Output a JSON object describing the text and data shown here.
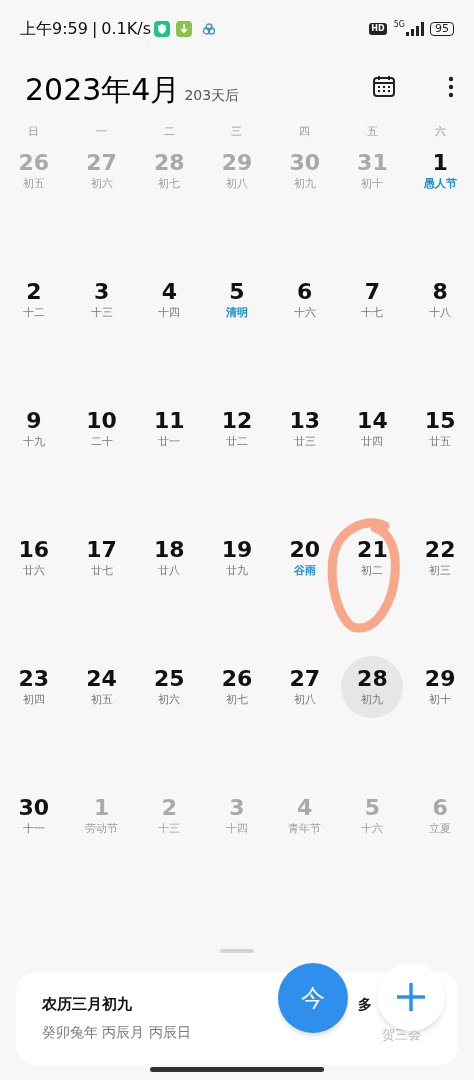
{
  "status_bar": {
    "time": "上午9:59",
    "separator": "|",
    "speed": "0.1K/s",
    "hd": "HD",
    "battery": "95",
    "network": "5G"
  },
  "header": {
    "title": "2023年4月",
    "subtitle": "203天后"
  },
  "weekdays": [
    "日",
    "一",
    "二",
    "三",
    "四",
    "五",
    "六"
  ],
  "days": [
    {
      "day": "26",
      "lunar": "初五",
      "in_month": false,
      "holiday": false,
      "selected": false
    },
    {
      "day": "27",
      "lunar": "初六",
      "in_month": false,
      "holiday": false,
      "selected": false
    },
    {
      "day": "28",
      "lunar": "初七",
      "in_month": false,
      "holiday": false,
      "selected": false
    },
    {
      "day": "29",
      "lunar": "初八",
      "in_month": false,
      "holiday": false,
      "selected": false
    },
    {
      "day": "30",
      "lunar": "初九",
      "in_month": false,
      "holiday": false,
      "selected": false
    },
    {
      "day": "31",
      "lunar": "初十",
      "in_month": false,
      "holiday": false,
      "selected": false
    },
    {
      "day": "1",
      "lunar": "愚人节",
      "in_month": true,
      "holiday": true,
      "selected": false
    },
    {
      "day": "2",
      "lunar": "十二",
      "in_month": true,
      "holiday": false,
      "selected": false
    },
    {
      "day": "3",
      "lunar": "十三",
      "in_month": true,
      "holiday": false,
      "selected": false
    },
    {
      "day": "4",
      "lunar": "十四",
      "in_month": true,
      "holiday": false,
      "selected": false
    },
    {
      "day": "5",
      "lunar": "清明",
      "in_month": true,
      "holiday": true,
      "selected": false
    },
    {
      "day": "6",
      "lunar": "十六",
      "in_month": true,
      "holiday": false,
      "selected": false
    },
    {
      "day": "7",
      "lunar": "十七",
      "in_month": true,
      "holiday": false,
      "selected": false
    },
    {
      "day": "8",
      "lunar": "十八",
      "in_month": true,
      "holiday": false,
      "selected": false
    },
    {
      "day": "9",
      "lunar": "十九",
      "in_month": true,
      "holiday": false,
      "selected": false
    },
    {
      "day": "10",
      "lunar": "二十",
      "in_month": true,
      "holiday": false,
      "selected": false
    },
    {
      "day": "11",
      "lunar": "廿一",
      "in_month": true,
      "holiday": false,
      "selected": false
    },
    {
      "day": "12",
      "lunar": "廿二",
      "in_month": true,
      "holiday": false,
      "selected": false
    },
    {
      "day": "13",
      "lunar": "廿三",
      "in_month": true,
      "holiday": false,
      "selected": false
    },
    {
      "day": "14",
      "lunar": "廿四",
      "in_month": true,
      "holiday": false,
      "selected": false
    },
    {
      "day": "15",
      "lunar": "廿五",
      "in_month": true,
      "holiday": false,
      "selected": false
    },
    {
      "day": "16",
      "lunar": "廿六",
      "in_month": true,
      "holiday": false,
      "selected": false
    },
    {
      "day": "17",
      "lunar": "廿七",
      "in_month": true,
      "holiday": false,
      "selected": false
    },
    {
      "day": "18",
      "lunar": "廿八",
      "in_month": true,
      "holiday": false,
      "selected": false
    },
    {
      "day": "19",
      "lunar": "廿九",
      "in_month": true,
      "holiday": false,
      "selected": false
    },
    {
      "day": "20",
      "lunar": "谷雨",
      "in_month": true,
      "holiday": true,
      "selected": false
    },
    {
      "day": "21",
      "lunar": "初二",
      "in_month": true,
      "holiday": false,
      "selected": false
    },
    {
      "day": "22",
      "lunar": "初三",
      "in_month": true,
      "holiday": false,
      "selected": false
    },
    {
      "day": "23",
      "lunar": "初四",
      "in_month": true,
      "holiday": false,
      "selected": false
    },
    {
      "day": "24",
      "lunar": "初五",
      "in_month": true,
      "holiday": false,
      "selected": false
    },
    {
      "day": "25",
      "lunar": "初六",
      "in_month": true,
      "holiday": false,
      "selected": false
    },
    {
      "day": "26",
      "lunar": "初七",
      "in_month": true,
      "holiday": false,
      "selected": false
    },
    {
      "day": "27",
      "lunar": "初八",
      "in_month": true,
      "holiday": false,
      "selected": false
    },
    {
      "day": "28",
      "lunar": "初九",
      "in_month": true,
      "holiday": false,
      "selected": true
    },
    {
      "day": "29",
      "lunar": "初十",
      "in_month": true,
      "holiday": false,
      "selected": false
    },
    {
      "day": "30",
      "lunar": "十一",
      "in_month": true,
      "holiday": false,
      "selected": false
    },
    {
      "day": "1",
      "lunar": "劳动节",
      "in_month": false,
      "holiday": false,
      "selected": false
    },
    {
      "day": "2",
      "lunar": "十三",
      "in_month": false,
      "holiday": false,
      "selected": false
    },
    {
      "day": "3",
      "lunar": "十四",
      "in_month": false,
      "holiday": false,
      "selected": false
    },
    {
      "day": "4",
      "lunar": "青年节",
      "in_month": false,
      "holiday": false,
      "selected": false
    },
    {
      "day": "5",
      "lunar": "十六",
      "in_month": false,
      "holiday": false,
      "selected": false
    },
    {
      "day": "6",
      "lunar": "立夏",
      "in_month": false,
      "holiday": false,
      "selected": false
    }
  ],
  "info_card": {
    "lunar_date": "农历三月初九",
    "ganzhi": "癸卯兔年 丙辰月 丙辰日",
    "right_top": "多",
    "right_bottom": "贺三会"
  },
  "today_button": "今"
}
